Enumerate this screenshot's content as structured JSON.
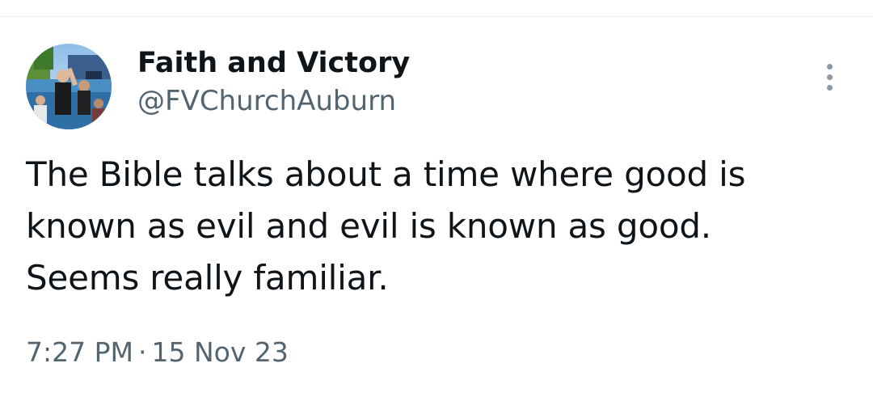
{
  "author": {
    "display_name": "Faith and Victory",
    "handle": "@FVChurchAuburn",
    "avatar_icon": "profile-photo"
  },
  "tweet": {
    "lines": [
      "The Bible talks about a time where good is",
      "known as evil and evil is known as good.",
      "Seems really familiar."
    ],
    "time": "7:27 PM",
    "separator": "·",
    "date": "15 Nov 23"
  },
  "menu": {
    "icon": "more-vertical-icon"
  },
  "colors": {
    "text": "#0f1419",
    "secondary": "#536471",
    "menu_dots": "#8b98a5"
  }
}
